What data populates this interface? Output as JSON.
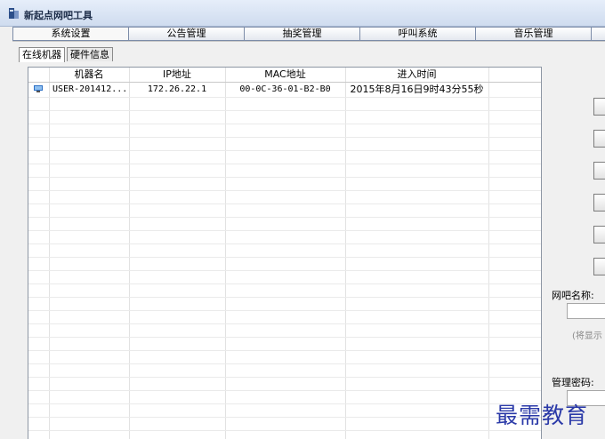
{
  "window": {
    "title": "新起点网吧工具"
  },
  "tabs": [
    {
      "label": "系统设置"
    },
    {
      "label": "公告管理"
    },
    {
      "label": "抽奖管理"
    },
    {
      "label": "呼叫系统"
    },
    {
      "label": "音乐管理"
    },
    {
      "label": ""
    }
  ],
  "subtabs": [
    {
      "label": "在线机器"
    },
    {
      "label": "硬件信息"
    }
  ],
  "table": {
    "columns": [
      "机器名",
      "IP地址",
      "MAC地址",
      "进入时间"
    ],
    "rows": [
      {
        "icon": "computer-icon",
        "name": "USER-201412...",
        "ip": "172.26.22.1",
        "mac": "00-0C-36-01-B2-B0",
        "time": "2015年8月16日9时43分55秒"
      }
    ]
  },
  "right_panel": {
    "netbar_name_label": "网吧名称:",
    "netbar_name_value": "",
    "netbar_name_hint": "(将显示",
    "admin_password_label": "管理密码:"
  },
  "watermark": "最需教育",
  "colors": {
    "title_bg": "#cfdcef",
    "watermark": "#2b3aa8",
    "icon_blue": "#2c6fc4"
  }
}
